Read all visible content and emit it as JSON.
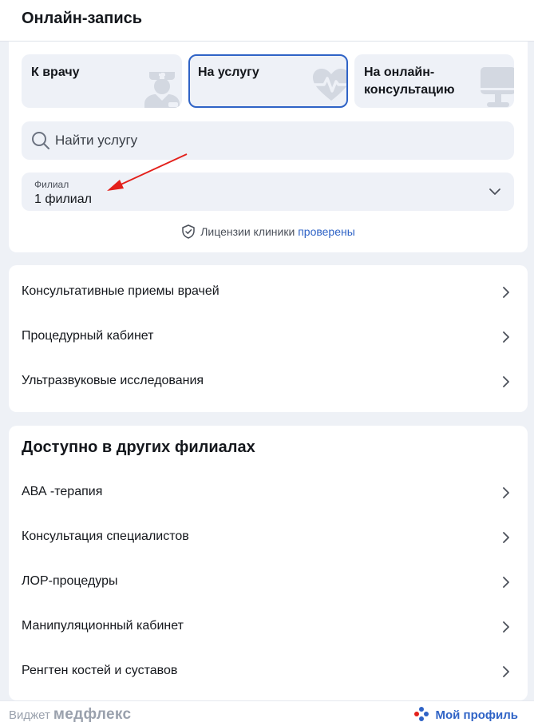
{
  "header": {
    "title": "Онлайн-запись"
  },
  "tabs": [
    {
      "label": "К врачу",
      "icon": "doctor-icon"
    },
    {
      "label": "На услугу",
      "icon": "heart-pulse-icon",
      "active": true
    },
    {
      "label_line1": "На онлайн-",
      "label_line2": "консультацию",
      "icon": "monitor-icon"
    }
  ],
  "search": {
    "placeholder": "Найти услугу"
  },
  "branch": {
    "caption": "Филиал",
    "value": "1 филиал"
  },
  "license": {
    "text": "Лицензии клиники",
    "link": "проверены"
  },
  "services": [
    "Консультативные приемы врачей",
    "Процедурный кабинет",
    "Ультразвуковые исследования"
  ],
  "other_branches": {
    "title": "Доступно в других филиалах",
    "items": [
      "АВА -терапия",
      "Консультация специалистов",
      "ЛОР-процедуры",
      "Манипуляционный кабинет",
      "Ренгтен костей и суставов"
    ]
  },
  "footer": {
    "widget_label": "Виджет",
    "brand": "медфлекс",
    "profile": "Мой профиль"
  },
  "colors": {
    "accent": "#2f63c6",
    "background": "#eef1f6",
    "annotation": "#e3201b"
  }
}
